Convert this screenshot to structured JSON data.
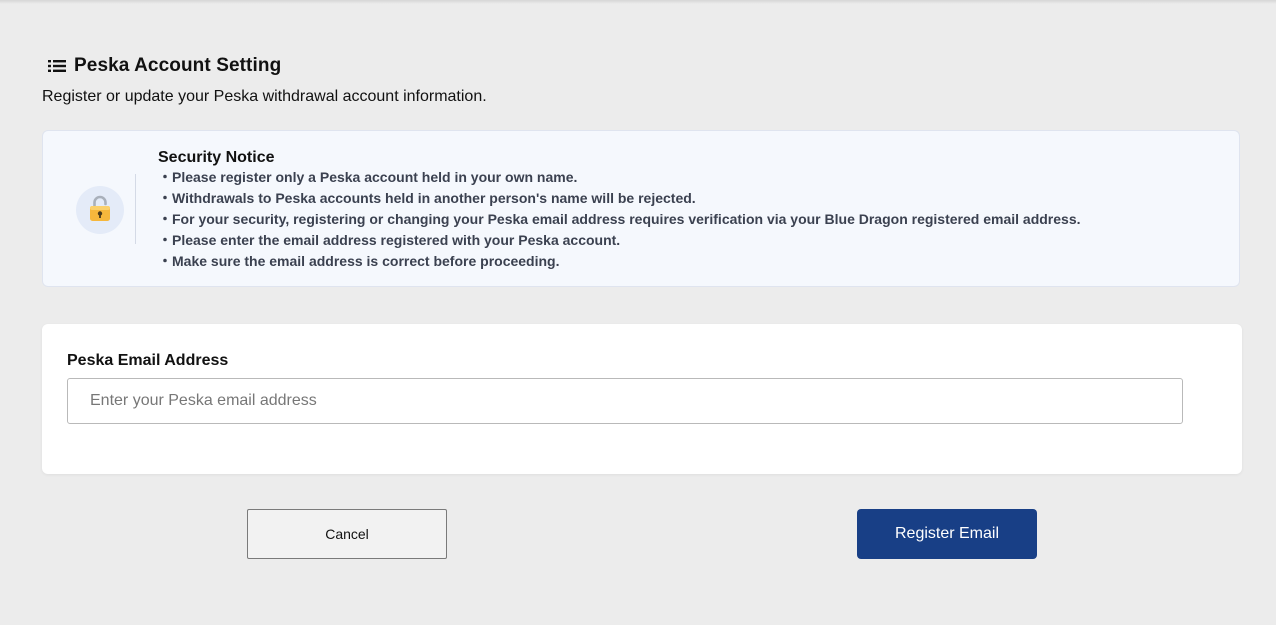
{
  "page": {
    "title": "Peska Account Setting",
    "subtitle": "Register or update your Peska withdrawal account information.",
    "title_icon": "list-icon"
  },
  "notice": {
    "icon": "lock-icon",
    "title": "Security Notice",
    "items": [
      "・Please register only a Peska account held in your own name.",
      "・Withdrawals to Peska accounts held in another person's name will be rejected.",
      "・For your security, registering or changing your Peska email address requires verification via your Blue Dragon registered email address.",
      "・Please enter the email address registered with your Peska account.",
      "・Make sure the email address is correct before proceeding."
    ]
  },
  "form": {
    "email_label": "Peska Email Address",
    "email_placeholder": "Enter your Peska email address",
    "email_value": ""
  },
  "actions": {
    "cancel_label": "Cancel",
    "register_label": "Register Email"
  },
  "colors": {
    "background": "#ececec",
    "notice_background": "#f5f8fd",
    "primary_button": "#183f86"
  }
}
